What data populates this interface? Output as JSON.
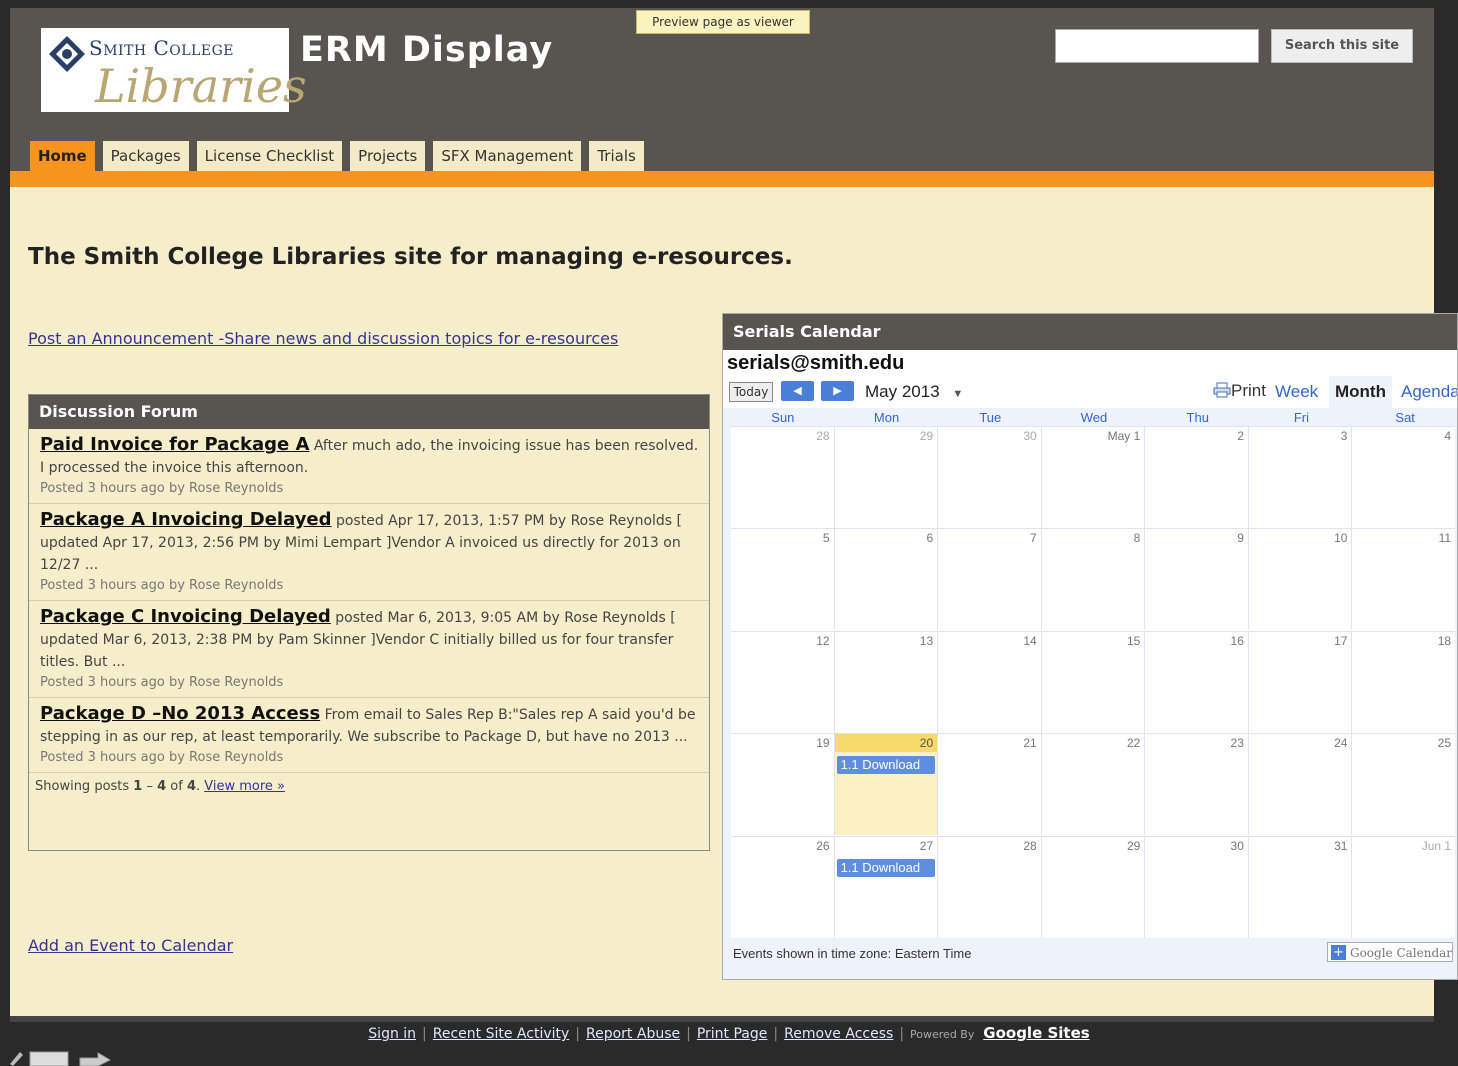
{
  "header": {
    "logo": {
      "line1": "Smith College",
      "line2": "Libraries"
    },
    "site_title": "ERM Display",
    "preview_button": "Preview page as viewer",
    "search": {
      "placeholder": "",
      "button_label": "Search this site"
    }
  },
  "nav": {
    "tabs": [
      {
        "label": "Home",
        "active": true
      },
      {
        "label": "Packages",
        "active": false
      },
      {
        "label": "License Checklist",
        "active": false
      },
      {
        "label": "Projects",
        "active": false
      },
      {
        "label": "SFX Management",
        "active": false
      },
      {
        "label": "Trials",
        "active": false
      }
    ]
  },
  "main": {
    "tagline": "The Smith College Libraries site for managing e-resources.",
    "announce_link": "Post an Announcement -Share news and discussion topics for e-resources",
    "add_event_link": "Add an Event to Calendar"
  },
  "forum": {
    "title": "Discussion Forum",
    "posts": [
      {
        "title": "Paid Invoice for Package A",
        "summary": " After much ado, the invoicing issue has been resolved.  I processed the invoice this afternoon.",
        "meta": "Posted 3 hours ago by Rose Reynolds"
      },
      {
        "title": "Package A Invoicing Delayed",
        "summary": " posted Apr 17, 2013, 1:57 PM by Rose Reynolds   [ updated Apr 17, 2013, 2:56 PM by Mimi Lempart ]Vendor A invoiced us directly for 2013 on 12/27 ...",
        "meta": "Posted 3 hours ago by Rose Reynolds"
      },
      {
        "title": "Package C Invoicing Delayed",
        "summary": " posted Mar 6, 2013, 9:05 AM by Rose Reynolds   [ updated Mar 6, 2013, 2:38 PM by Pam Skinner ]Vendor C initially billed us for four transfer titles.  But ...",
        "meta": "Posted 3 hours ago by Rose Reynolds"
      },
      {
        "title": "Package D –No 2013 Access",
        "summary": " From email to Sales Rep B:\"Sales rep A said you'd be stepping in as our rep, at least temporarily. We subscribe to Package D, but have no 2013 ...",
        "meta": "Posted 3 hours ago by Rose Reynolds"
      }
    ],
    "footer": {
      "prefix": "Showing posts ",
      "from": "1",
      "dash": " – ",
      "to": "4",
      "of_text": " of ",
      "total": "4",
      "end": ". ",
      "view_more": "View more »"
    }
  },
  "calendar": {
    "title": "Serials Calendar",
    "email": "serials@smith.edu",
    "today_label": "Today",
    "prev_icon": "◀",
    "next_icon": "▶",
    "month_label": "May 2013",
    "dropdown_icon": "▼",
    "print_label": "Print",
    "views": [
      "Week",
      "Month",
      "Agenda"
    ],
    "selected_view": "Month",
    "days_of_week": [
      "Sun",
      "Mon",
      "Tue",
      "Wed",
      "Thu",
      "Fri",
      "Sat"
    ],
    "weeks": [
      [
        {
          "n": "28",
          "other": true
        },
        {
          "n": "29",
          "other": true
        },
        {
          "n": "30",
          "other": true
        },
        {
          "n": "May 1"
        },
        {
          "n": "2"
        },
        {
          "n": "3"
        },
        {
          "n": "4"
        }
      ],
      [
        {
          "n": "5"
        },
        {
          "n": "6"
        },
        {
          "n": "7"
        },
        {
          "n": "8"
        },
        {
          "n": "9"
        },
        {
          "n": "10"
        },
        {
          "n": "11"
        }
      ],
      [
        {
          "n": "12"
        },
        {
          "n": "13"
        },
        {
          "n": "14"
        },
        {
          "n": "15"
        },
        {
          "n": "16"
        },
        {
          "n": "17"
        },
        {
          "n": "18"
        }
      ],
      [
        {
          "n": "19"
        },
        {
          "n": "20",
          "today": true,
          "event": "1.1 Download"
        },
        {
          "n": "21"
        },
        {
          "n": "22"
        },
        {
          "n": "23"
        },
        {
          "n": "24"
        },
        {
          "n": "25"
        }
      ],
      [
        {
          "n": "26"
        },
        {
          "n": "27",
          "event": "1.1 Download"
        },
        {
          "n": "28"
        },
        {
          "n": "29"
        },
        {
          "n": "30"
        },
        {
          "n": "31"
        },
        {
          "n": "Jun 1",
          "other": true
        }
      ]
    ],
    "timezone_text": "Events shown in time zone: Eastern Time",
    "gcal_badge": "Google Calendar"
  },
  "footer": {
    "links": [
      "Sign in",
      "Recent Site Activity",
      "Report Abuse",
      "Print Page",
      "Remove Access"
    ],
    "powered_by": "Powered By",
    "google_sites": "Google Sites"
  },
  "colors": {
    "accent": "#f7941d",
    "header_bg": "#585551",
    "page_bg": "#f6eecb",
    "link": "#333399",
    "calendar_event": "#5f8ee0"
  }
}
